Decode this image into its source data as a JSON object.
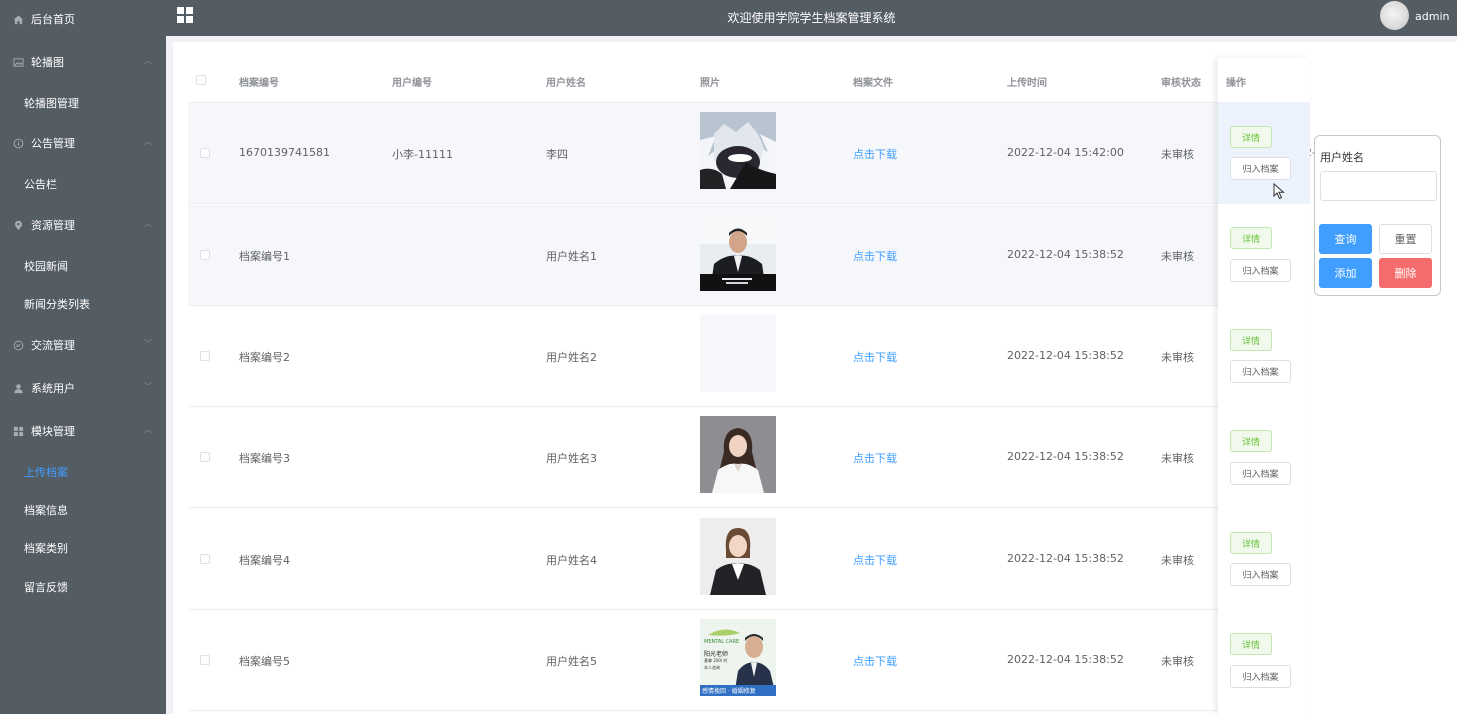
{
  "sidebar": {
    "items": [
      {
        "label": "后台首页",
        "icon": "home-icon"
      },
      {
        "label": "轮播图",
        "icon": "picture-icon"
      },
      {
        "label": "轮播图管理"
      },
      {
        "label": "公告管理",
        "icon": "info-icon"
      },
      {
        "label": "公告栏"
      },
      {
        "label": "资源管理",
        "icon": "location-icon"
      },
      {
        "label": "校园新闻"
      },
      {
        "label": "新闻分类列表"
      },
      {
        "label": "交流管理",
        "icon": "chat-icon"
      },
      {
        "label": "系统用户",
        "icon": "user-icon"
      },
      {
        "label": "模块管理",
        "icon": "grid-icon"
      },
      {
        "label": "上传档案",
        "active": true
      },
      {
        "label": "档案信息"
      },
      {
        "label": "档案类别"
      },
      {
        "label": "留言反馈"
      }
    ]
  },
  "header": {
    "title": "欢迎使用学院学生档案管理系统",
    "user": "admin"
  },
  "table": {
    "columns": [
      "档案编号",
      "用户编号",
      "用户姓名",
      "照片",
      "档案文件",
      "上传时间",
      "审核状态",
      "操作"
    ],
    "rows": [
      {
        "archive_no": "1670139741581",
        "user_no": "小李-11111",
        "user_name": "李四",
        "file": "点击下载",
        "upload_time": "2022-12-04 15:42:00",
        "status": "未审核"
      },
      {
        "archive_no": "档案编号1",
        "user_no": "",
        "user_name": "用户姓名1",
        "file": "点击下载",
        "upload_time": "2022-12-04 15:38:52",
        "status": "未审核"
      },
      {
        "archive_no": "档案编号2",
        "user_no": "",
        "user_name": "用户姓名2",
        "file": "点击下载",
        "upload_time": "2022-12-04 15:38:52",
        "status": "未审核"
      },
      {
        "archive_no": "档案编号3",
        "user_no": "",
        "user_name": "用户姓名3",
        "file": "点击下载",
        "upload_time": "2022-12-04 15:38:52",
        "status": "未审核"
      },
      {
        "archive_no": "档案编号4",
        "user_no": "",
        "user_name": "用户姓名4",
        "file": "点击下载",
        "upload_time": "2022-12-04 15:38:52",
        "status": "未审核"
      },
      {
        "archive_no": "档案编号5",
        "user_no": "",
        "user_name": "用户姓名5",
        "file": "点击下载",
        "upload_time": "2022-12-04 15:38:52",
        "status": "未审核"
      }
    ],
    "overflow_text": "2022-",
    "detail_label": "详情",
    "archive_label": "归入档案",
    "photo5_text": {
      "line1": "MENTAL CARE",
      "line2": "阳光老师",
      "line3": "基尊 200/ 时",
      "line4": "本人咨询",
      "banner": "感情挽回 · 婚姻修复"
    }
  },
  "search": {
    "label": "用户姓名",
    "value": "",
    "query": "查询",
    "reset": "重置",
    "add": "添加",
    "delete": "删除"
  },
  "colors": {
    "sidebar_bg": "#545c64",
    "primary": "#409eff",
    "danger": "#f56c6c",
    "success": "#67c23a"
  }
}
